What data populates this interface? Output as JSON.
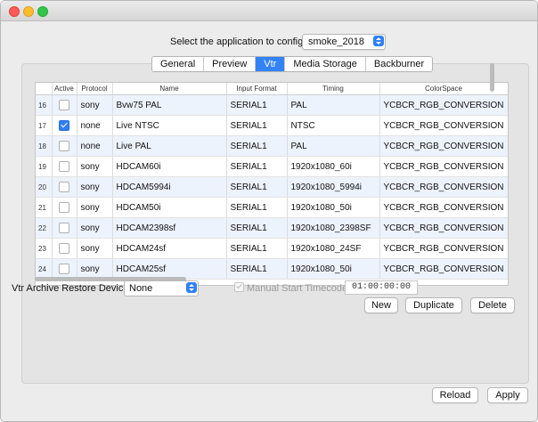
{
  "window": {
    "title": ""
  },
  "app_select": {
    "label": "Select the application to configure",
    "value": "smoke_2018"
  },
  "tabs": [
    {
      "label": "General",
      "active": false
    },
    {
      "label": "Preview",
      "active": false
    },
    {
      "label": "Vtr",
      "active": true
    },
    {
      "label": "Media Storage",
      "active": false
    },
    {
      "label": "Backburner",
      "active": false
    }
  ],
  "table": {
    "columns": [
      "",
      "Active",
      "Protocol",
      "Name",
      "Input Format",
      "Timing",
      "ColorSpace"
    ],
    "rows": [
      {
        "num": "16",
        "active": false,
        "protocol": "sony",
        "name": "Bvw75 PAL",
        "input_format": "SERIAL1",
        "timing": "PAL",
        "colorspace": "YCBCR_RGB_CONVERSION"
      },
      {
        "num": "17",
        "active": true,
        "protocol": "none",
        "name": "Live NTSC",
        "input_format": "SERIAL1",
        "timing": "NTSC",
        "colorspace": "YCBCR_RGB_CONVERSION"
      },
      {
        "num": "18",
        "active": false,
        "protocol": "none",
        "name": "Live PAL",
        "input_format": "SERIAL1",
        "timing": "PAL",
        "colorspace": "YCBCR_RGB_CONVERSION"
      },
      {
        "num": "19",
        "active": false,
        "protocol": "sony",
        "name": "HDCAM60i",
        "input_format": "SERIAL1",
        "timing": "1920x1080_60i",
        "colorspace": "YCBCR_RGB_CONVERSION"
      },
      {
        "num": "20",
        "active": false,
        "protocol": "sony",
        "name": "HDCAM5994i",
        "input_format": "SERIAL1",
        "timing": "1920x1080_5994i",
        "colorspace": "YCBCR_RGB_CONVERSION"
      },
      {
        "num": "21",
        "active": false,
        "protocol": "sony",
        "name": "HDCAM50i",
        "input_format": "SERIAL1",
        "timing": "1920x1080_50i",
        "colorspace": "YCBCR_RGB_CONVERSION"
      },
      {
        "num": "22",
        "active": false,
        "protocol": "sony",
        "name": "HDCAM2398sf",
        "input_format": "SERIAL1",
        "timing": "1920x1080_2398SF",
        "colorspace": "YCBCR_RGB_CONVERSION"
      },
      {
        "num": "23",
        "active": false,
        "protocol": "sony",
        "name": "HDCAM24sf",
        "input_format": "SERIAL1",
        "timing": "1920x1080_24SF",
        "colorspace": "YCBCR_RGB_CONVERSION"
      },
      {
        "num": "24",
        "active": false,
        "protocol": "sony",
        "name": "HDCAM25sf",
        "input_format": "SERIAL1",
        "timing": "1920x1080_50i",
        "colorspace": "YCBCR_RGB_CONVERSION"
      }
    ]
  },
  "table_buttons": {
    "new": "New",
    "duplicate": "Duplicate",
    "delete": "Delete"
  },
  "vtr_archive": {
    "label": "Vtr Archive Restore Device",
    "value": "None"
  },
  "manual_start": {
    "label": "Manual Start Timecode",
    "checked": true,
    "enabled": false,
    "timecode": "01:00:00:00"
  },
  "footer": {
    "reload": "Reload",
    "apply": "Apply"
  },
  "colors": {
    "accent": "#3383f7",
    "row_alt": "#edf3fd",
    "close": "#fc5b57",
    "minimize": "#fdbc2e",
    "maximize": "#33c748"
  },
  "icons": {
    "stepper": "updown-stepper-icon",
    "check": "checkmark-icon"
  }
}
